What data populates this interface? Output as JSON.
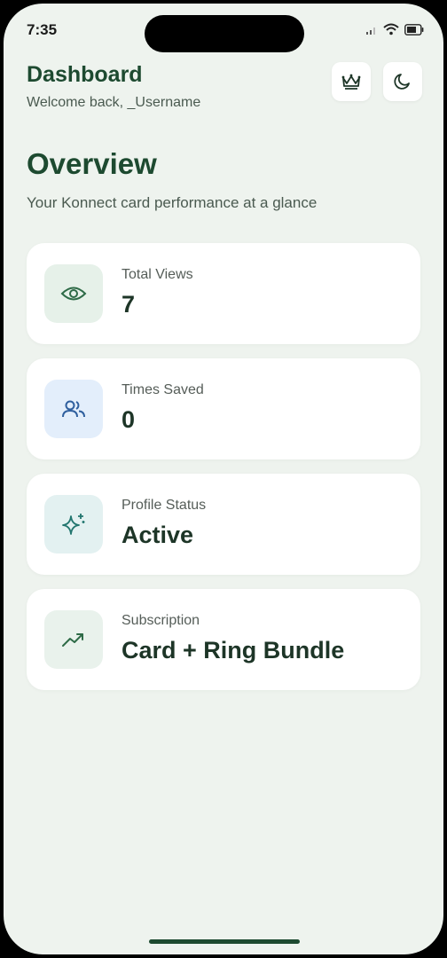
{
  "status_bar": {
    "time": "7:35"
  },
  "header": {
    "title": "Dashboard",
    "welcome": "Welcome back, _Username"
  },
  "overview": {
    "title": "Overview",
    "subtitle": "Your Konnect card performance at a glance"
  },
  "stats": [
    {
      "label": "Total Views",
      "value": "7",
      "icon": "eye-icon",
      "icon_bg": "#e6f1e9",
      "icon_color": "#2e6b47"
    },
    {
      "label": "Times Saved",
      "value": "0",
      "icon": "users-icon",
      "icon_bg": "#e3eefb",
      "icon_color": "#2f5f9e"
    },
    {
      "label": "Profile Status",
      "value": "Active",
      "icon": "sparkles-icon",
      "icon_bg": "#e3f1f1",
      "icon_color": "#22766f"
    },
    {
      "label": "Subscription",
      "value": "Card + Ring Bundle",
      "icon": "trending-up-icon",
      "icon_bg": "#e9f2ec",
      "icon_color": "#2e6b47"
    }
  ],
  "colors": {
    "background": "#eef3ee",
    "primary": "#1d4a30"
  }
}
